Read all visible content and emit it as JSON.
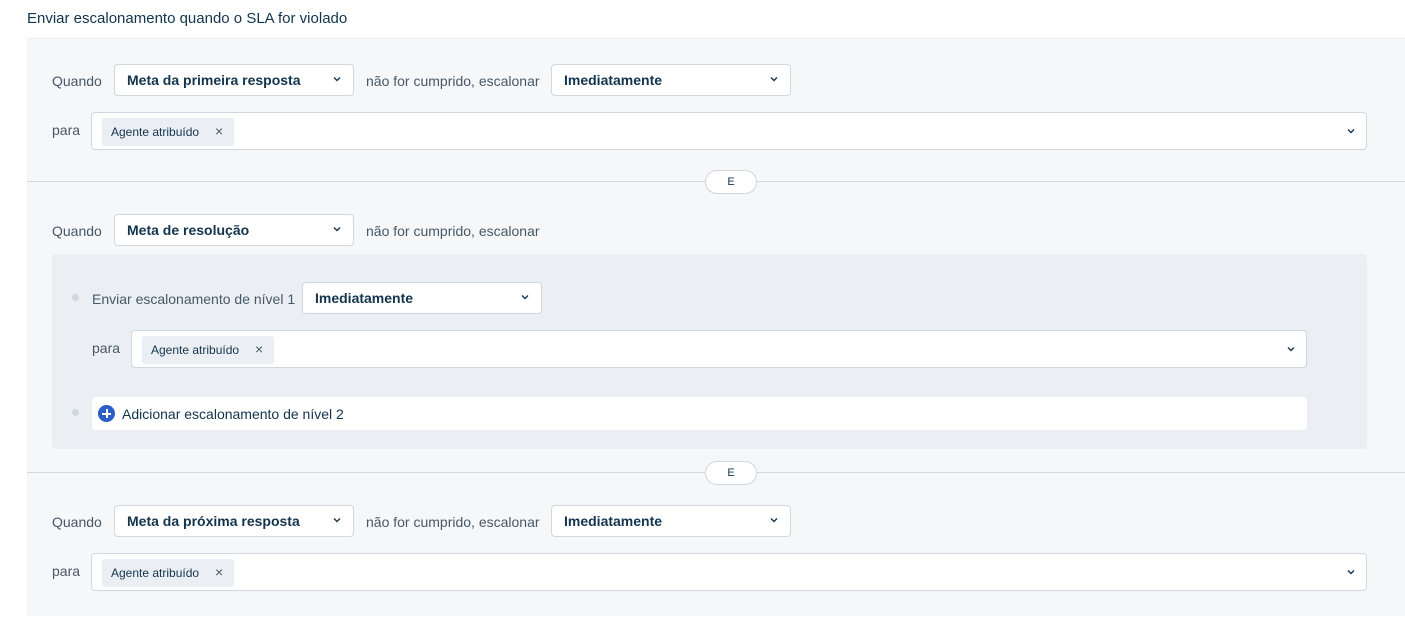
{
  "page_title": "Enviar escalonamento quando o SLA for violado",
  "colors": {
    "panel_bg": "#f5f7f9",
    "nested_bg": "#ebeff3",
    "border": "#cfd7df",
    "accent": "#2c5cc5",
    "text": "#12344d"
  },
  "rules": [
    {
      "when_label": "Quando",
      "metric": "Meta da primeira resposta",
      "condition_text": "não for cumprido, escalonar",
      "timing": "Imediatamente",
      "to_label": "para",
      "assignee_tag": "Agente atribuído"
    },
    {
      "when_label": "Quando",
      "metric": "Meta de resolução",
      "condition_text": "não for cumprido, escalonar",
      "levels": [
        {
          "label": "Enviar escalonamento de nível 1",
          "timing": "Imediatamente",
          "to_label": "para",
          "assignee_tag": "Agente atribuído"
        }
      ],
      "add_level_label": "Adicionar escalonamento de nível 2"
    },
    {
      "when_label": "Quando",
      "metric": "Meta da próxima resposta",
      "condition_text": "não for cumprido, escalonar",
      "timing": "Imediatamente",
      "to_label": "para",
      "assignee_tag": "Agente atribuído"
    }
  ],
  "connector_label": "E",
  "icons": {
    "dropdown": "chevron-down-icon",
    "remove_tag": "close-icon",
    "add": "plus-circle-icon",
    "bullet": "bullet-dot-icon"
  }
}
